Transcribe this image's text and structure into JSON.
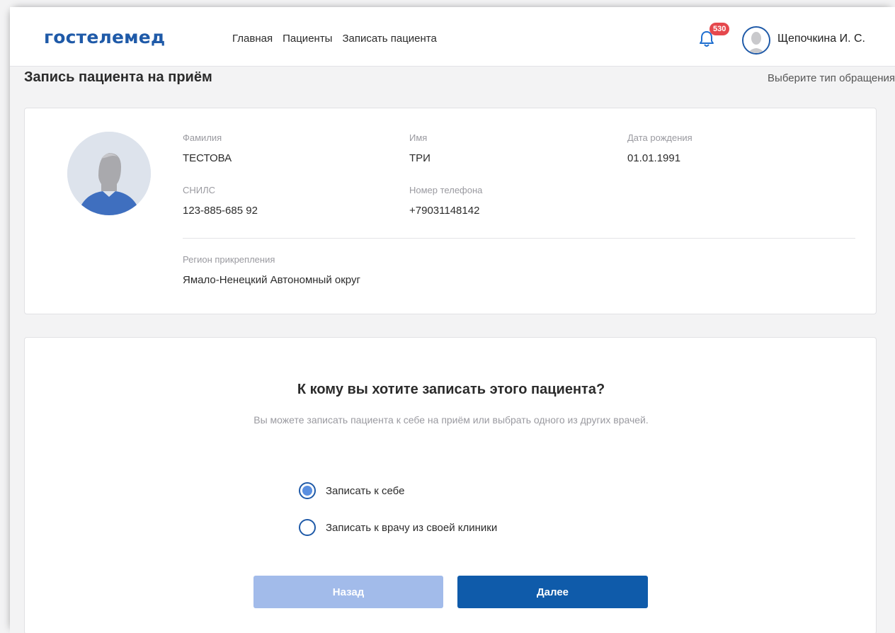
{
  "header": {
    "logo": "гостелемед",
    "nav": [
      "Главная",
      "Пациенты",
      "Записать пациента"
    ],
    "notifications_count": "530",
    "user_name": "Щепочкина И. С."
  },
  "page": {
    "title": "Запись пациента на приём",
    "step_hint": "Выберите тип обращения"
  },
  "patient": {
    "surname_label": "Фамилия",
    "surname": "ТЕСТОВА",
    "name_label": "Имя",
    "name": "ТРИ",
    "birthdate_label": "Дата рождения",
    "birthdate": "01.01.1991",
    "snils_label": "СНИЛС",
    "snils": "123-885-685 92",
    "phone_label": "Номер телефона",
    "phone": "+79031148142",
    "region_label": "Регион прикрепления",
    "region": "Ямало-Ненецкий Автономный округ"
  },
  "choice": {
    "title": "К кому вы хотите записать этого пациента?",
    "subtitle": "Вы можете записать пациента к себе на приём или выбрать одного из других врачей.",
    "options": [
      {
        "label": "Записать к себе",
        "selected": true
      },
      {
        "label": "Записать к врачу из своей клиники",
        "selected": false
      }
    ],
    "back_label": "Назад",
    "next_label": "Далее"
  },
  "colors": {
    "brand": "#1f5aa8",
    "primary_button": "#0f5baa",
    "disabled_button": "#a2bbea",
    "badge": "#e5484d"
  }
}
